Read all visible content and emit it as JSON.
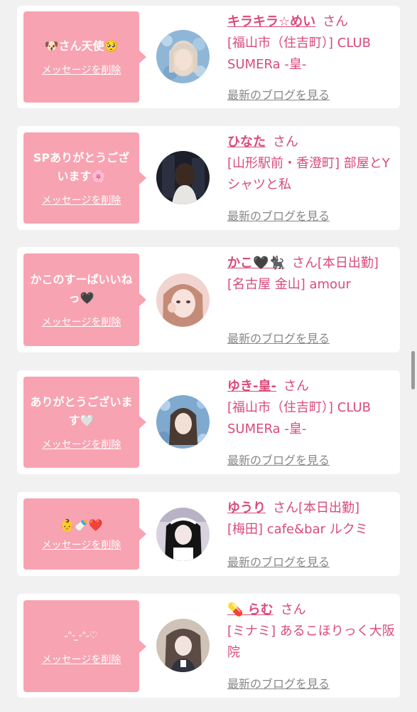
{
  "delete_label": "メッセージを削除",
  "blog_label": "最新のブログを見る",
  "san_label": "さん",
  "colors": {
    "bubble": "#f7a3b1",
    "accent": "#d94b79",
    "page_bg": "#f1f1f1",
    "card_bg": "#ffffff"
  },
  "cards": [
    {
      "message": "🐶さん天使🥺",
      "name": "キラキラ☆めい",
      "status": "",
      "shop": "[福山市（住吉町）] CLUB SUMERa -皇-",
      "avatar_icon": "girl-photo-blonde-avatar"
    },
    {
      "message": "SPありがとうございます🌸",
      "name": "ひなた",
      "status": "",
      "shop": "[山形駅前・香澄町] 部屋とYシャツと私",
      "avatar_icon": "girl-photo-dark-avatar"
    },
    {
      "message": "かこのすーぱいいねっ🖤",
      "name": "かこ🖤🐈‍⬛",
      "status": "[本日出勤]",
      "shop": "[名古屋 金山] amour",
      "avatar_icon": "girl-photo-pink-avatar"
    },
    {
      "message": "ありがとうございます🤍",
      "name": "ゆき-皇-",
      "status": "",
      "shop": "[福山市（住吉町）] CLUB SUMERa -皇-",
      "avatar_icon": "girl-photo-blue-avatar"
    },
    {
      "message": "👶🍼❤️",
      "name": "ゆうり",
      "status": "[本日出勤]",
      "shop": "[梅田] cafe&bar ルクミ",
      "avatar_icon": "girl-photo-maid-avatar"
    },
    {
      "message": "˶ᐢ- ̫-ᐢ˶♡",
      "name": "💊 らむ",
      "status": "",
      "shop": "[ミナミ] あるこほりっく大阪院",
      "avatar_icon": "girl-photo-uniform-avatar"
    }
  ]
}
